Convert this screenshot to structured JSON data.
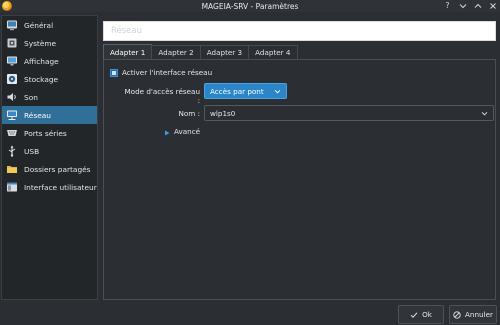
{
  "window": {
    "title": "MAGEIA-SRV - Paramètres",
    "controls": [
      "help-icon",
      "minimize-icon",
      "maximize-icon",
      "close-icon"
    ]
  },
  "sidebar": {
    "items": [
      {
        "label": "Général",
        "icon": "general-icon",
        "active": false
      },
      {
        "label": "Système",
        "icon": "system-icon",
        "active": false
      },
      {
        "label": "Affichage",
        "icon": "display-icon",
        "active": false
      },
      {
        "label": "Stockage",
        "icon": "storage-icon",
        "active": false
      },
      {
        "label": "Son",
        "icon": "audio-icon",
        "active": false
      },
      {
        "label": "Réseau",
        "icon": "network-icon",
        "active": true
      },
      {
        "label": "Ports séries",
        "icon": "serial-ports-icon",
        "active": false
      },
      {
        "label": "USB",
        "icon": "usb-icon",
        "active": false
      },
      {
        "label": "Dossiers partagés",
        "icon": "shared-folders-icon",
        "active": false
      },
      {
        "label": "Interface utilisateur",
        "icon": "user-interface-icon",
        "active": false
      }
    ]
  },
  "header": {
    "title": "Réseau"
  },
  "tabs": [
    {
      "label": "Adapter 1",
      "active": true
    },
    {
      "label": "Adapter 2",
      "active": false
    },
    {
      "label": "Adapter 3",
      "active": false
    },
    {
      "label": "Adapter 4",
      "active": false
    }
  ],
  "adapter": {
    "enable_label": "Activer l'interface réseau",
    "enabled": true,
    "mode_label": "Mode d'accès réseau :",
    "mode_value": "Accès par pont",
    "name_label": "Nom :",
    "name_value": "wlp1s0",
    "advanced_label": "Avancé"
  },
  "buttons": {
    "ok": "Ok",
    "cancel": "Annuler"
  },
  "colors": {
    "accent": "#2a86c9",
    "sidebar_active": "#2f6f98",
    "background": "#2b2e33"
  }
}
